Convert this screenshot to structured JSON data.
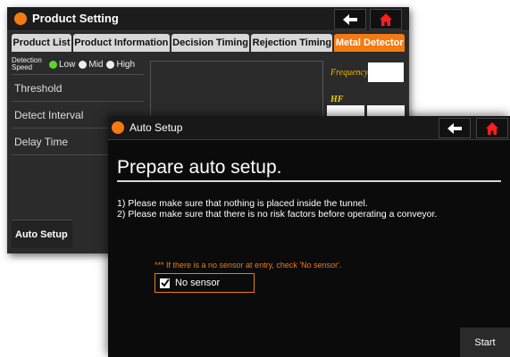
{
  "colors": {
    "accent": "#f47a12",
    "home": "#ff1e1e",
    "radio_on": "#5fd32a"
  },
  "back_window": {
    "title": "Product Setting",
    "tabs": [
      {
        "label": "Product List"
      },
      {
        "label": "Product Information"
      },
      {
        "label": "Decision Timing"
      },
      {
        "label": "Rejection Timing"
      },
      {
        "label": "Metal Detector",
        "active": true
      }
    ],
    "detection_speed": {
      "label": "Detection Speed",
      "options": [
        {
          "label": "Low",
          "selected": true
        },
        {
          "label": "Mid"
        },
        {
          "label": "High"
        }
      ]
    },
    "rows": [
      "Threshold",
      "Detect Interval",
      "Delay Time"
    ],
    "frequency_label": "Frequency",
    "hf_label": "HF",
    "auto_setup_label": "Auto Setup"
  },
  "front_window": {
    "title": "Auto Setup",
    "heading": "Prepare auto setup.",
    "instructions": [
      "1) Please make sure that nothing is placed inside the tunnel.",
      "2) Please make sure that there is no risk factors before operating a conveyor."
    ],
    "sensor_note": "*** If there is a no sensor at entry, check 'No sensor'.",
    "no_sensor_label": "No sensor",
    "no_sensor_checked": true,
    "start_label": "Start"
  }
}
